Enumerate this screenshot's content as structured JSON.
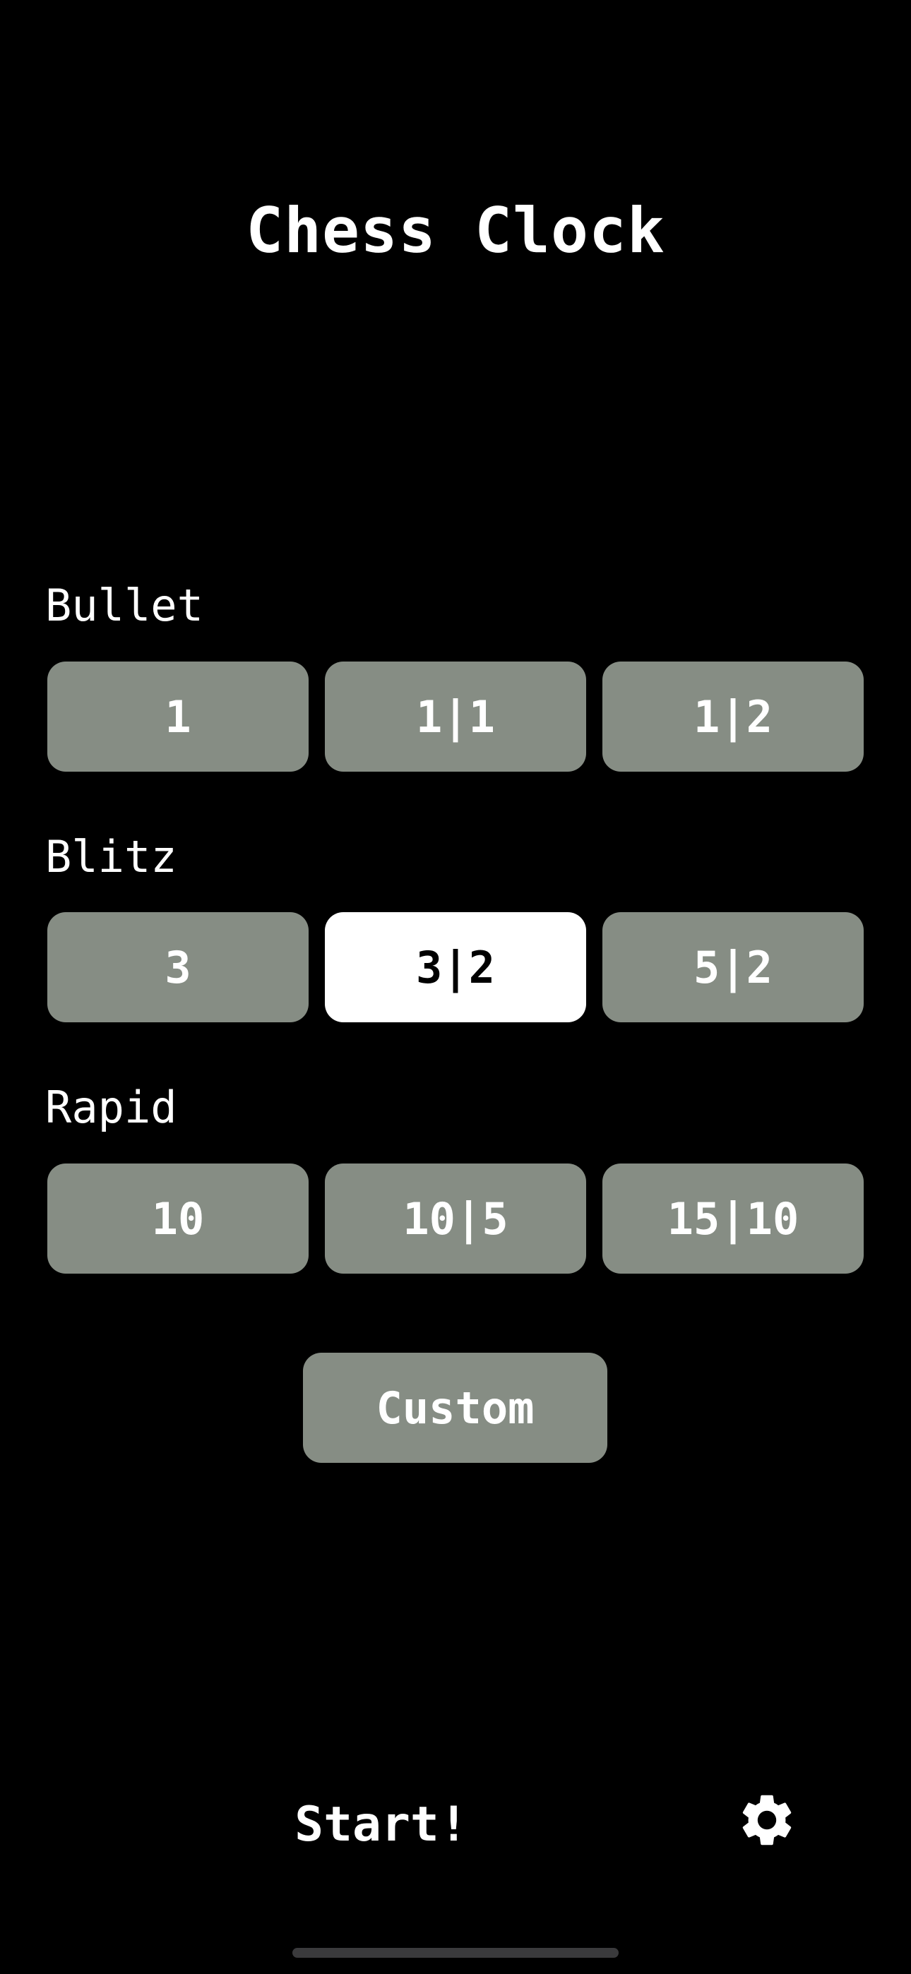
{
  "header": {
    "title": "Chess Clock"
  },
  "sections": [
    {
      "label": "Bullet",
      "presets": [
        {
          "label": "1",
          "selected": false
        },
        {
          "label": "1|1",
          "selected": false
        },
        {
          "label": "1|2",
          "selected": false
        }
      ]
    },
    {
      "label": "Blitz",
      "presets": [
        {
          "label": "3",
          "selected": false
        },
        {
          "label": "3|2",
          "selected": true
        },
        {
          "label": "5|2",
          "selected": false
        }
      ]
    },
    {
      "label": "Rapid",
      "presets": [
        {
          "label": "10",
          "selected": false
        },
        {
          "label": "10|5",
          "selected": false
        },
        {
          "label": "15|10",
          "selected": false
        }
      ]
    }
  ],
  "custom": {
    "label": "Custom"
  },
  "footer": {
    "start_label": "Start!",
    "settings_icon": "gear-icon"
  },
  "colors": {
    "background": "#000000",
    "button": "#868d84",
    "selected_button": "#ffffff",
    "text": "#ffffff"
  }
}
